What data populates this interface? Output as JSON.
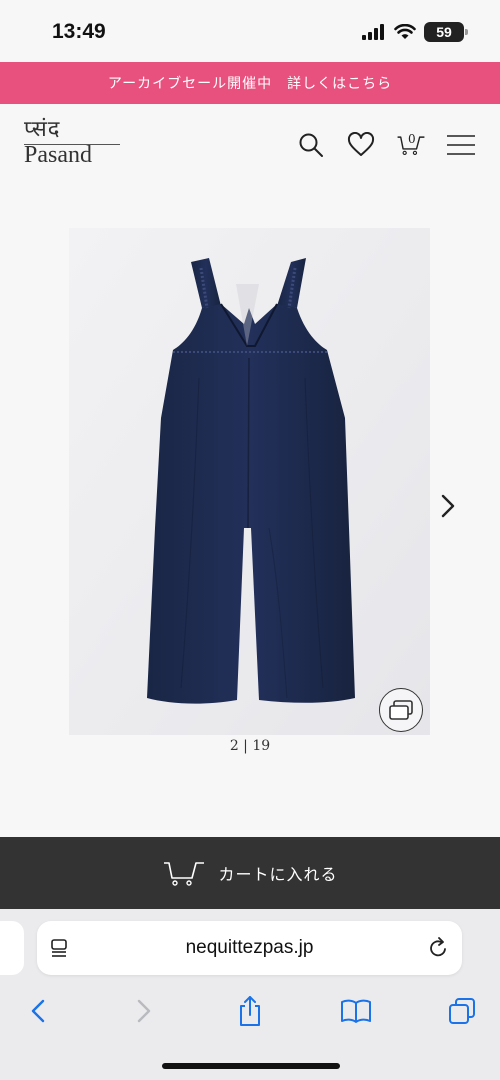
{
  "status": {
    "time": "13:49",
    "battery": "59"
  },
  "announcement": {
    "text": "アーカイブセール開催中　詳しくはこちら"
  },
  "header": {
    "logo_devanagari": "प्संद",
    "logo_latin": "Pasand",
    "cart_count": "0"
  },
  "gallery": {
    "counter": "2 | 19"
  },
  "cart": {
    "label": "カートに入れる"
  },
  "browser": {
    "url": "nequittezpas.jp"
  },
  "colors": {
    "announcement_bg": "#e8507e",
    "cartbar_bg": "#333333",
    "garment": "#1d2a4a"
  },
  "icons": [
    "signal-icon",
    "wifi-icon",
    "battery-icon",
    "search-icon",
    "heart-icon",
    "cart-icon",
    "menu-icon",
    "chevron-right-icon",
    "gallery-icon",
    "reader-icon",
    "reload-icon",
    "back-icon",
    "forward-icon",
    "share-icon",
    "bookmarks-icon",
    "tabs-icon"
  ]
}
